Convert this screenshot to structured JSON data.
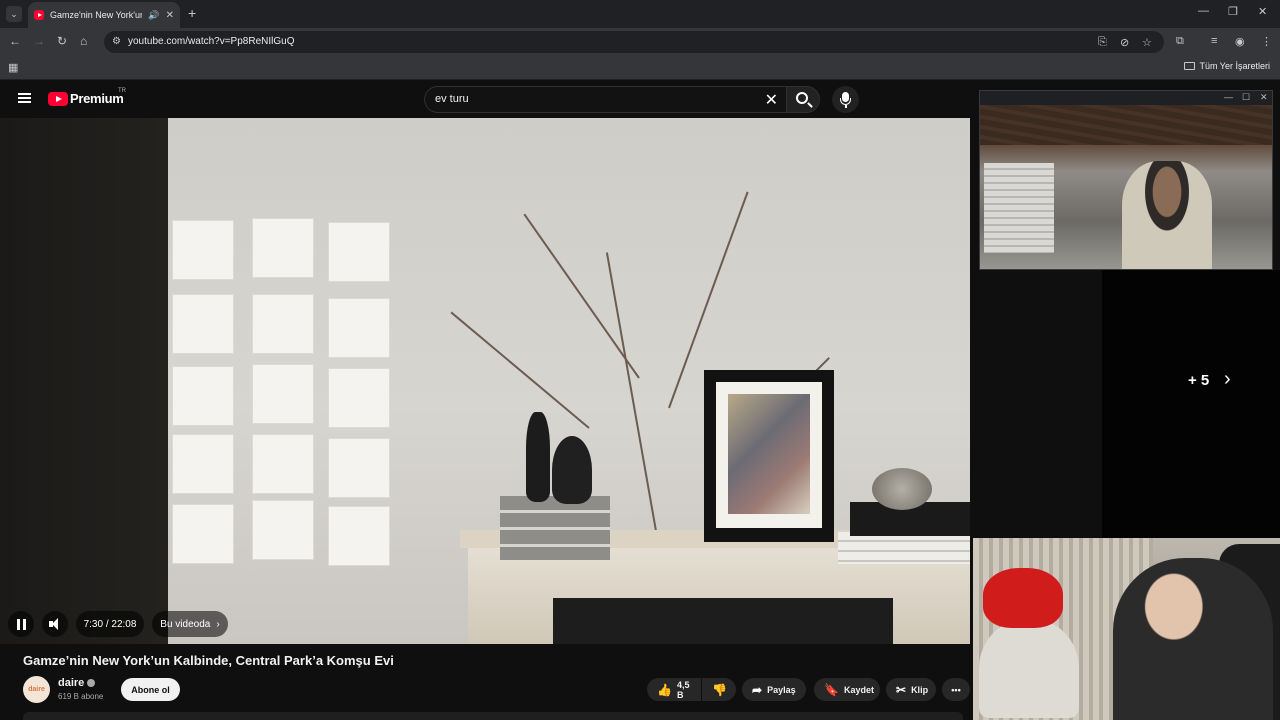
{
  "browser": {
    "tab_title": "Gamze'nin New York'un Kalbinde",
    "url": "youtube.com/watch?v=Pp8ReNIlGuQ",
    "bookmarks_all": "Tüm Yer İşaretleri",
    "new_tab": "+",
    "win_minimize": "—",
    "win_restore": "❐",
    "win_close": "✕"
  },
  "youtube": {
    "brand": "Premium",
    "region": "TR",
    "search_value": "ev turu"
  },
  "player": {
    "time": "7:30 / 22:08",
    "chapter_button": "Bu videoda",
    "more_count": "+ 5",
    "progress_fraction": 0.339
  },
  "video": {
    "title": "Gamze’nin New York’un Kalbinde, Central Park’a Komşu Evi",
    "channel_name": "daire",
    "channel_avatar_text": "daire",
    "subscribers": "619 B abone",
    "subscribe_label": "Abone ol",
    "likes": "4,5 B",
    "share_label": "Paylaş",
    "save_label": "Kaydet",
    "clip_label": "Klip",
    "more_label": "•••"
  },
  "colors": {
    "accent_red": "#ff0000",
    "background": "#0f0f0f"
  }
}
